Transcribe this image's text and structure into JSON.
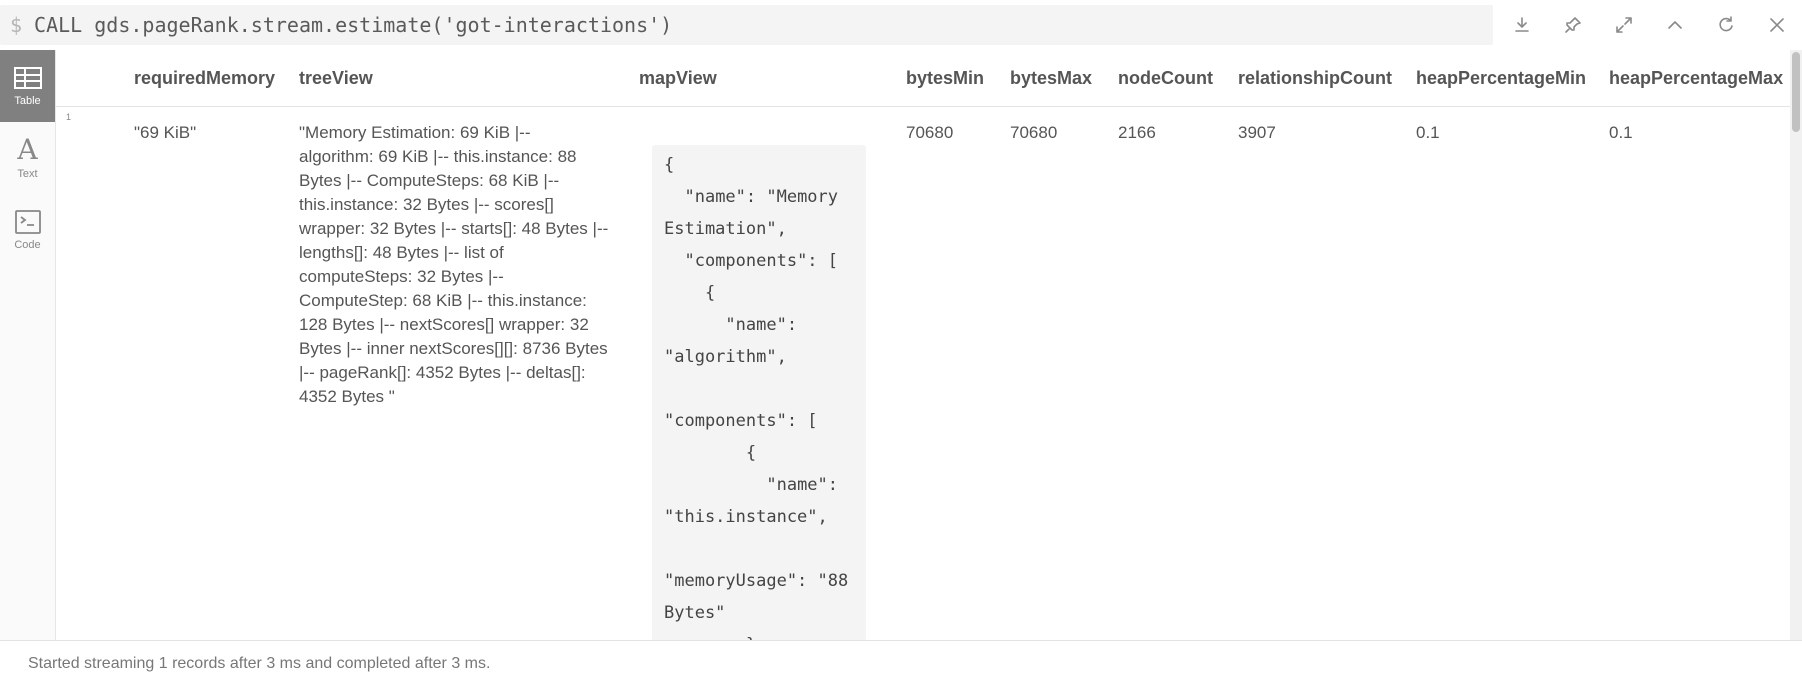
{
  "query": {
    "prompt": "$",
    "text": "CALL gds.pageRank.stream.estimate('got-interactions')"
  },
  "toolbar": [
    "download-icon",
    "pin-icon",
    "expand-icon",
    "collapse-icon",
    "rerun-icon",
    "close-icon"
  ],
  "sidebar": {
    "items": [
      {
        "label": "Table",
        "icon": "table-icon",
        "active": true
      },
      {
        "label": "Text",
        "icon": "text-icon",
        "active": false
      },
      {
        "label": "Code",
        "icon": "code-icon",
        "active": false
      }
    ]
  },
  "table": {
    "columns": [
      "requiredMemory",
      "treeView",
      "mapView",
      "bytesMin",
      "bytesMax",
      "nodeCount",
      "relationshipCount",
      "heapPercentageMin",
      "heapPercentageMax"
    ],
    "row": {
      "number": "1",
      "requiredMemory": "\"69 KiB\"",
      "treeView": "\"Memory Estimation: 69 KiB |-- algorithm: 69 KiB |-- this.instance: 88 Bytes |-- ComputeSteps: 68 KiB |-- this.instance: 32 Bytes |-- scores[] wrapper: 32 Bytes |-- starts[]: 48 Bytes |-- lengths[]: 48 Bytes |-- list of computeSteps: 32 Bytes |-- ComputeStep: 68 KiB |-- this.instance: 128 Bytes |-- nextScores[] wrapper: 32 Bytes |-- inner nextScores[][]: 8736 Bytes |-- pageRank[]: 4352 Bytes |-- deltas[]: 4352 Bytes \"",
      "mapView": "{\n  \"name\": \"Memory Estimation\",\n  \"components\": [\n    {\n      \"name\": \"algorithm\",\n      \"components\": [\n        {\n          \"name\": \"this.instance\",\n          \"memoryUsage\": \"88 Bytes\"\n        },",
      "bytesMin": "70680",
      "bytesMax": "70680",
      "nodeCount": "2166",
      "relationshipCount": "3907",
      "heapPercentageMin": "0.1",
      "heapPercentageMax": "0.1"
    }
  },
  "status": "Started streaming 1 records after 3 ms and completed after 3 ms."
}
